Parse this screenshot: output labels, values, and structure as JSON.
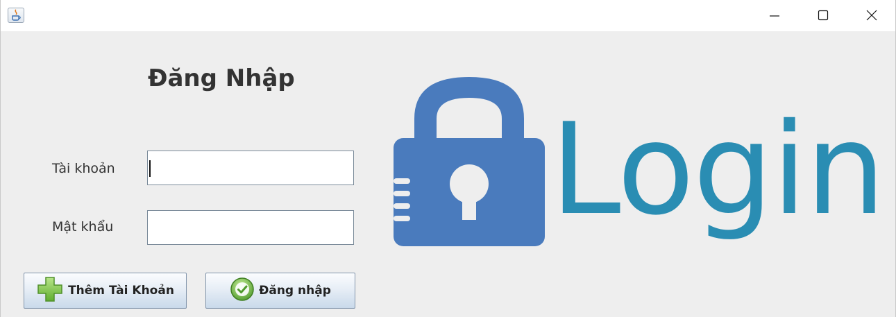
{
  "window": {
    "controls": {
      "minimize_icon": "minimize-icon",
      "maximize_icon": "maximize-icon",
      "close_icon": "close-icon"
    }
  },
  "form": {
    "heading": "Đăng Nhập",
    "username": {
      "label": "Tài khoản",
      "value": ""
    },
    "password": {
      "label": "Mật khẩu",
      "value": ""
    }
  },
  "buttons": {
    "add_account": "Thêm Tài Khoản",
    "login": "Đăng nhập"
  },
  "logo": {
    "text": "Login",
    "lock_color": "#4a7bbd",
    "text_color": "#2a8db3"
  },
  "colors": {
    "background": "#eeeeee",
    "titlebar": "#ffffff"
  }
}
